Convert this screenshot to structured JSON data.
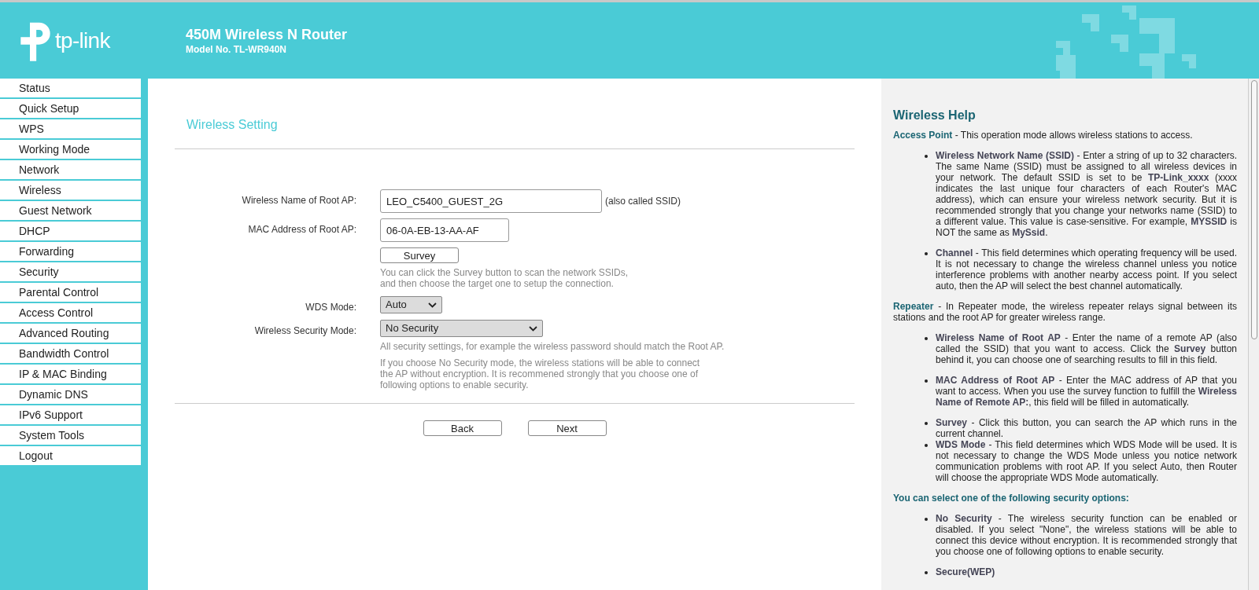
{
  "header": {
    "brand": "tp-link",
    "title": "450M Wireless N Router",
    "model": "Model No. TL-WR940N"
  },
  "sidebar": {
    "items": [
      {
        "label": "Status"
      },
      {
        "label": "Quick Setup"
      },
      {
        "label": "WPS"
      },
      {
        "label": "Working Mode"
      },
      {
        "label": "Network"
      },
      {
        "label": "Wireless"
      },
      {
        "label": "Guest Network"
      },
      {
        "label": "DHCP"
      },
      {
        "label": "Forwarding"
      },
      {
        "label": "Security"
      },
      {
        "label": "Parental Control"
      },
      {
        "label": "Access Control"
      },
      {
        "label": "Advanced Routing"
      },
      {
        "label": "Bandwidth Control"
      },
      {
        "label": "IP & MAC Binding"
      },
      {
        "label": "Dynamic DNS"
      },
      {
        "label": "IPv6 Support"
      },
      {
        "label": "System Tools"
      },
      {
        "label": "Logout"
      }
    ]
  },
  "form": {
    "title": "Wireless Setting",
    "rows": [
      {
        "kind": "input",
        "label": "Wireless Name of Root AP:",
        "value": "LEO_C5400_GUEST_2G",
        "suffix": "(also called SSID)",
        "wide": true
      },
      {
        "kind": "input",
        "label": "MAC Address of Root AP:",
        "value": "06-0A-EB-13-AA-AF",
        "wide": false
      },
      {
        "kind": "button",
        "label": "Survey",
        "notes": [
          "You can click the Survey button to scan the network SSIDs,\nand then choose the target one to setup the connection."
        ]
      },
      {
        "kind": "select",
        "label": "WDS Mode:",
        "value": "Auto",
        "wide": false
      },
      {
        "kind": "select",
        "label": "Wireless Security Mode:",
        "value": "No Security",
        "wide": true,
        "notes": [
          "All security settings, for example the wireless password should match the Root AP.",
          "If you choose No Security mode, the wireless stations will be able to connect\nthe AP without encryption. It is recommened strongly that you choose one of\nfollowing options to enable security."
        ]
      }
    ],
    "buttons": [
      "Back",
      "Next"
    ]
  },
  "help": {
    "title": "Wireless Help",
    "blocks": [
      {
        "kind": "para",
        "text": "**Access Point** - This operation mode allows wireless stations to access."
      },
      {
        "kind": "list",
        "items": [
          "**Wireless Network Name (SSID)** - Enter a string of up to 32 characters. The same Name (SSID) must be assigned to all wireless devices in your network. The default SSID is set to be **TP-Link_xxxx** (xxxx indicates the last unique four characters of each Router's MAC address), which can ensure your wireless network security. But it is recommended strongly that you change your networks name (SSID) to a different value. This value is case-sensitive. For example, **MYSSID** is NOT the same as **MySsid**.",
          "**Channel** - This field determines which operating frequency will be used. It is not necessary to change the wireless channel unless you notice interference problems with another nearby access point. If you select auto, then the AP will select the best channel automatically."
        ]
      },
      {
        "kind": "para",
        "text": "**Repeater** - In Repeater mode, the wireless repeater relays signal between its stations and the root AP for greater wireless range."
      },
      {
        "kind": "list",
        "items": [
          "**Wireless Name of Root AP** - Enter the name of a remote AP (also called the SSID) that you want to access. Click the **Survey** button behind it, you can choose one of searching results to fill in this field.",
          "**MAC Address of Root AP** - Enter the MAC address of AP that you want to access. When you use the survey function to fulfill the **Wireless Name of Remote AP:**, this field will be filled in automatically."
        ]
      },
      {
        "kind": "tightlist",
        "items": [
          "**Survey** - Click this button, you can search the AP which runs in the current channel.",
          "**WDS Mode** - This field determines which WDS Mode will be used. It is not necessary to change the WDS Mode unless you notice network communication problems with root AP. If you select Auto, then Router will choose the appropriate WDS Mode automatically."
        ]
      },
      {
        "kind": "heading",
        "text": "You can select one of the following security options:"
      },
      {
        "kind": "list",
        "items": [
          "**No Security** - The wireless security function can be enabled or disabled. If you select \"None\", the wireless stations will be able to connect this device without encryption. It is recommended strongly that you choose one of following options to enable security.",
          "**Secure(WEP)**"
        ]
      }
    ]
  }
}
